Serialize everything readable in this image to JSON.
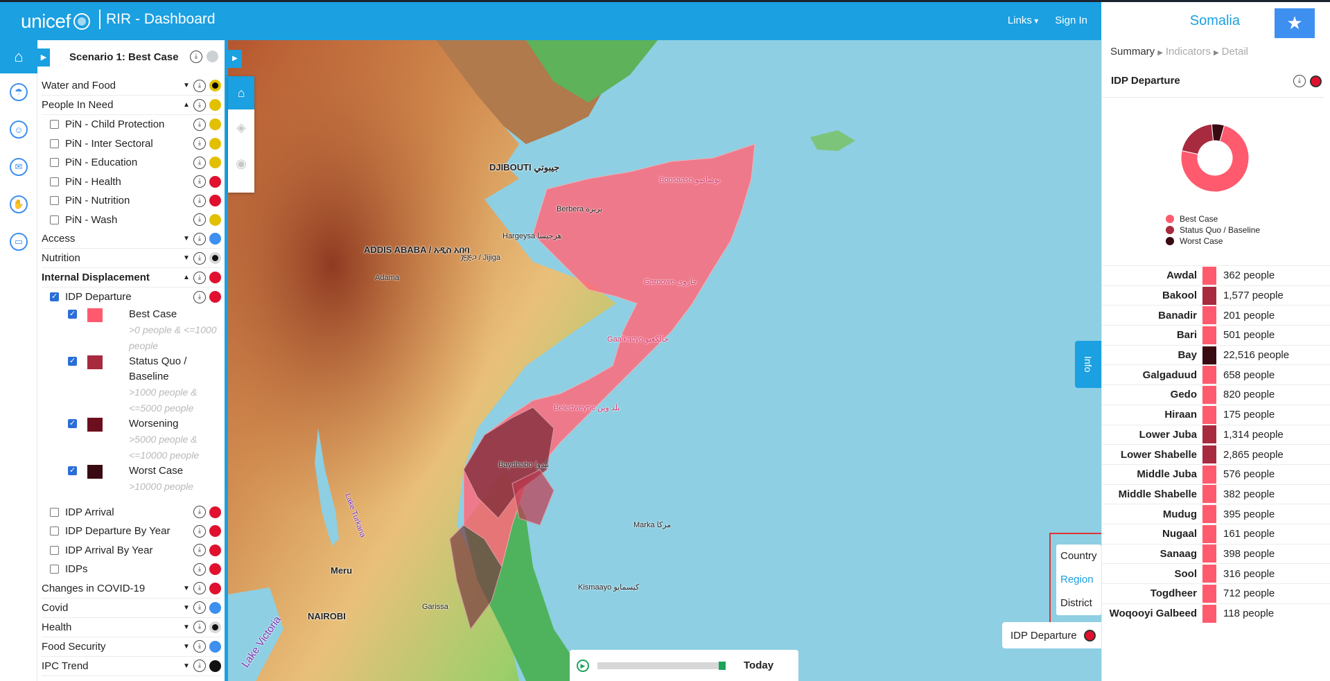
{
  "header": {
    "logo_text": "unicef",
    "app_title": "RIR - Dashboard",
    "links_label": "Links",
    "signin_label": "Sign In",
    "country": "Somalia"
  },
  "panel": {
    "scenario_title": "Scenario 1: Best Case",
    "groups": [
      {
        "label": "Water and Food",
        "bold": false,
        "expanded": false,
        "color": "#000000",
        "ring": "#e2c000"
      },
      {
        "label": "People In Need",
        "bold": false,
        "expanded": true,
        "color": "#e2c000"
      },
      {
        "label": "Access",
        "bold": false,
        "expanded": false,
        "color": "#3d8ff0"
      },
      {
        "label": "Nutrition",
        "bold": false,
        "expanded": false,
        "color": "#111111",
        "ring": "#d8d8d8"
      },
      {
        "label": "Internal Displacement",
        "bold": true,
        "expanded": true,
        "color": "#e0102e"
      },
      {
        "label": "Changes in COVID-19",
        "bold": false,
        "expanded": false,
        "color": "#e0102e"
      },
      {
        "label": "Covid",
        "bold": false,
        "expanded": false,
        "color": "#3d8ff0"
      },
      {
        "label": "Health",
        "bold": false,
        "expanded": false,
        "color": "#111111",
        "ring": "#d8d8d8"
      },
      {
        "label": "Food Security",
        "bold": false,
        "expanded": false,
        "color": "#3d8ff0"
      },
      {
        "label": "IPC Trend",
        "bold": false,
        "expanded": false,
        "color": "#111111"
      }
    ],
    "pin_items": [
      {
        "label": "PiN - Child Protection",
        "color": "#e2c000"
      },
      {
        "label": "PiN - Inter Sectoral",
        "color": "#e2c000"
      },
      {
        "label": "PiN - Education",
        "color": "#e2c000"
      },
      {
        "label": "PiN - Health",
        "color": "#e0102e"
      },
      {
        "label": "PiN - Nutrition",
        "color": "#e0102e"
      },
      {
        "label": "PiN - Wash",
        "color": "#e2c000"
      }
    ],
    "idp_departure": {
      "label": "IDP Departure",
      "checked": true,
      "color": "#e0102e"
    },
    "legend": [
      {
        "title": "Best Case",
        "range": ">0 people & <=1000 people",
        "color": "#ff5a6e"
      },
      {
        "title": "Status Quo / Baseline",
        "range": ">1000 people & <=5000 people",
        "color": "#a82a3e"
      },
      {
        "title": "Worsening",
        "range": ">5000 people & <=10000 people",
        "color": "#6b0f1e"
      },
      {
        "title": "Worst Case",
        "range": ">10000 people",
        "color": "#3a0a12"
      }
    ],
    "idp_others": [
      {
        "label": "IDP Arrival",
        "color": "#e0102e"
      },
      {
        "label": "IDP Departure By Year",
        "color": "#e0102e"
      },
      {
        "label": "IDP Arrival By Year",
        "color": "#e0102e"
      },
      {
        "label": "IDPs",
        "color": "#e0102e"
      }
    ]
  },
  "map": {
    "labels": {
      "djibouti": "DJIBOUTI جيبوتي",
      "addis": "ADDIS ABABA / አዲስ አበባ",
      "nairobi": "NAIROBI",
      "lake_turkana": "Lake Turkana",
      "lake_victoria": "Lake Victoria",
      "hargeysa": "Hargeysa هرجيسا",
      "beledweyne": "Beledweyne بلد وين",
      "galkacyo": "Gaalkacyo جالكعيو",
      "bosaaso": "Boosaaso بوصاصو",
      "garissa": "Garissa",
      "meru": "Meru",
      "kismayo": "Kismaayo كيسمايو",
      "adama": "Adama",
      "jijiga": "ጅጅጋ / Jijiga",
      "berbera": "Berbera بربرة",
      "garowe": "Garoowe جاروي",
      "baydhabo": "Baydhabo بيدوا",
      "marka": "Marka مركا"
    },
    "level_options": [
      "Country",
      "Region",
      "District"
    ],
    "active_level": "Region",
    "legend_chip": "IDP Departure",
    "timeline_label": "Today",
    "info_tab": "Info"
  },
  "right": {
    "crumbs": [
      "Summary",
      "Indicators",
      "Detail"
    ],
    "title": "IDP Departure",
    "donut": [
      {
        "label": "Best Case",
        "value": 0.74,
        "color": "#ff5a6e"
      },
      {
        "label": "Status Quo / Baseline",
        "value": 0.2,
        "color": "#a82a3e"
      },
      {
        "label": "Worst Case",
        "value": 0.06,
        "color": "#3a0a12"
      }
    ],
    "regions": [
      {
        "name": "Awdal",
        "value": "362 people",
        "color": "#ff5a6e"
      },
      {
        "name": "Bakool",
        "value": "1,577 people",
        "color": "#a82a3e"
      },
      {
        "name": "Banadir",
        "value": "201 people",
        "color": "#ff5a6e"
      },
      {
        "name": "Bari",
        "value": "501 people",
        "color": "#ff5a6e"
      },
      {
        "name": "Bay",
        "value": "22,516 people",
        "color": "#3a0a12"
      },
      {
        "name": "Galgaduud",
        "value": "658 people",
        "color": "#ff5a6e"
      },
      {
        "name": "Gedo",
        "value": "820 people",
        "color": "#ff5a6e"
      },
      {
        "name": "Hiraan",
        "value": "175 people",
        "color": "#ff5a6e"
      },
      {
        "name": "Lower Juba",
        "value": "1,314 people",
        "color": "#a82a3e"
      },
      {
        "name": "Lower Shabelle",
        "value": "2,865 people",
        "color": "#a82a3e"
      },
      {
        "name": "Middle Juba",
        "value": "576 people",
        "color": "#ff5a6e"
      },
      {
        "name": "Middle Shabelle",
        "value": "382 people",
        "color": "#ff5a6e"
      },
      {
        "name": "Mudug",
        "value": "395 people",
        "color": "#ff5a6e"
      },
      {
        "name": "Nugaal",
        "value": "161 people",
        "color": "#ff5a6e"
      },
      {
        "name": "Sanaag",
        "value": "398 people",
        "color": "#ff5a6e"
      },
      {
        "name": "Sool",
        "value": "316 people",
        "color": "#ff5a6e"
      },
      {
        "name": "Togdheer",
        "value": "712 people",
        "color": "#ff5a6e"
      },
      {
        "name": "Woqooyi Galbeed",
        "value": "118 people",
        "color": "#ff5a6e"
      }
    ]
  }
}
